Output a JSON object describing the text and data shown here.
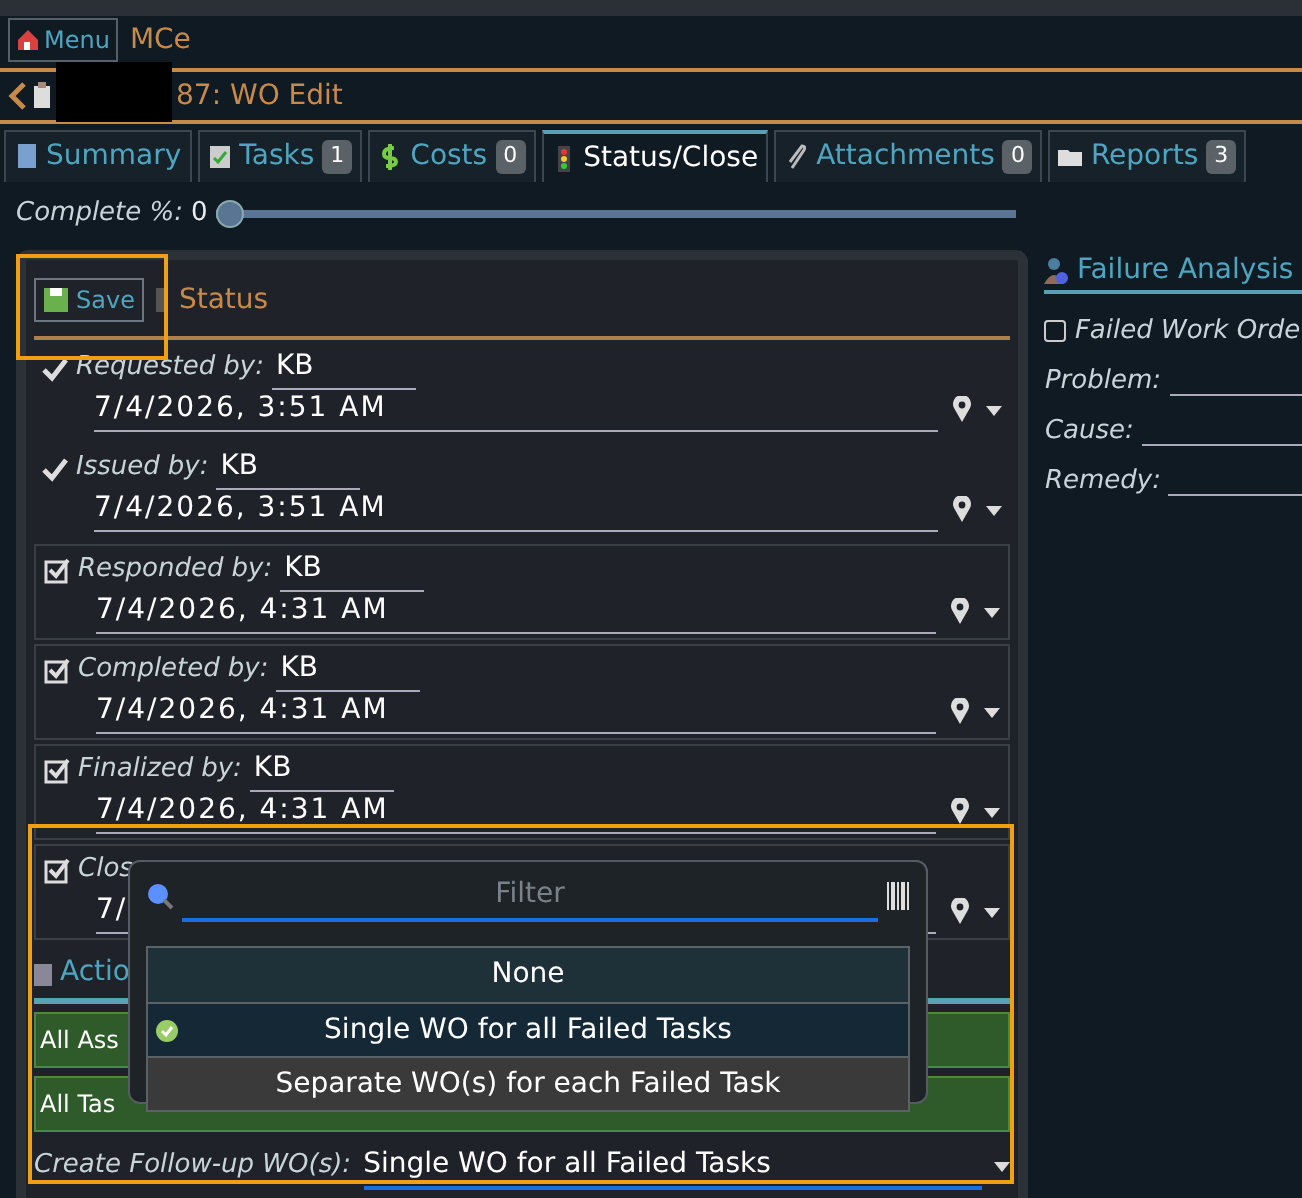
{
  "header": {
    "menu_button": "Menu",
    "app_name": "MCe"
  },
  "title_bar": {
    "title": "87: WO Edit"
  },
  "tabs": [
    {
      "label": "Summary",
      "selected": false
    },
    {
      "label": "Tasks",
      "count": "1",
      "selected": false
    },
    {
      "label": "Costs",
      "count": "0",
      "selected": false
    },
    {
      "label": "Status/Close",
      "selected": true
    },
    {
      "label": "Attachments",
      "count": "0",
      "selected": false
    },
    {
      "label": "Reports",
      "count": "3",
      "selected": false
    }
  ],
  "complete": {
    "label": "Complete %:",
    "value": "0",
    "level": 0
  },
  "status_panel": {
    "save_button": "Save",
    "title": "Status",
    "rows": [
      {
        "kind": "check",
        "label": "Requested",
        "by_label": "by:",
        "by": "KB",
        "date": "7/4/2026, 3:51 AM",
        "checked": true
      },
      {
        "kind": "check",
        "label": "Issued",
        "by_label": "by:",
        "by": "KB",
        "date": "7/4/2026, 3:51 AM",
        "checked": true
      },
      {
        "kind": "checkbox",
        "label": "Responded",
        "by_label": "by:",
        "by": "KB",
        "date": "7/4/2026, 4:31 AM",
        "checked": true
      },
      {
        "kind": "checkbox",
        "label": "Completed",
        "by_label": "by:",
        "by": "KB",
        "date": "7/4/2026, 4:31 AM",
        "checked": true
      },
      {
        "kind": "checkbox",
        "label": "Finalized",
        "by_label": "by:",
        "by": "KB",
        "date": "7/4/2026, 4:31 AM",
        "checked": true
      },
      {
        "kind": "checkbox",
        "label": "Clos",
        "date": "7/",
        "checked": true
      }
    ],
    "actions_title": "Actio",
    "action_rows": [
      "All Ass",
      "All Tas"
    ],
    "follow_up": {
      "label": "Create Follow-up WO(s):",
      "value": "Single WO for all Failed Tasks"
    }
  },
  "dropdown": {
    "placeholder": "Filter",
    "options": [
      {
        "label": "None",
        "selected": false
      },
      {
        "label": "Single WO for all Failed Tasks",
        "selected": true
      },
      {
        "label": "Separate WO(s) for each Failed Task",
        "selected": false
      }
    ]
  },
  "failure_panel": {
    "title": "Failure Analysis",
    "failed_checkbox": {
      "label": "Failed Work Orde",
      "checked": false
    },
    "fields": [
      {
        "label": "Problem:"
      },
      {
        "label": "Cause:"
      },
      {
        "label": "Remedy:"
      }
    ]
  }
}
